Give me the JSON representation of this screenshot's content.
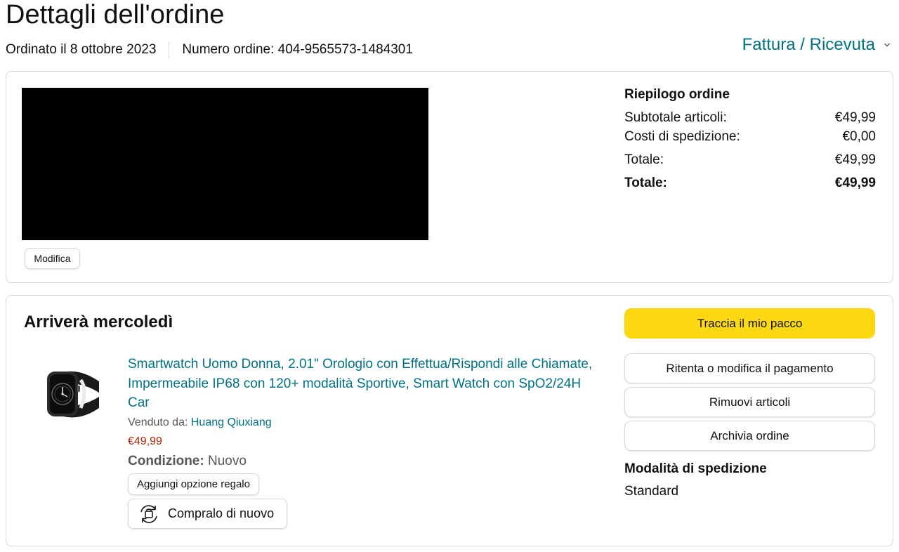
{
  "page": {
    "title": "Dettagli dell'ordine",
    "order_date": "Ordinato il 8 ottobre 2023",
    "order_number": "Numero ordine: 404-9565573-1484301",
    "invoice_link": "Fattura / Ricevuta"
  },
  "address_card": {
    "edit_button": "Modifica"
  },
  "summary": {
    "title": "Riepilogo ordine",
    "rows": [
      {
        "label": "Subtotale articoli:",
        "value": "€49,99"
      },
      {
        "label": "Costi di spedizione:",
        "value": "€0,00"
      },
      {
        "label": "Totale:",
        "value": "€49,99"
      },
      {
        "label": "Totale:",
        "value": "€49,99"
      }
    ]
  },
  "shipment": {
    "arrival": "Arriverà mercoledì",
    "product": {
      "title": "Smartwatch Uomo Donna, 2.01\" Orologio con Effettua/Rispondi alle Chiamate, Impermeabile IP68 con 120+ modalità Sportive, Smart Watch con SpO2/24H Car",
      "sold_by_label": "Venduto da:",
      "seller": "Huang Qiuxiang",
      "price": "€49,99",
      "condition_label": "Condizione:",
      "condition_value": "Nuovo"
    },
    "gift_button": "Aggiungi opzione regalo",
    "buy_again_button": "Compralo di nuovo",
    "actions": {
      "track": "Traccia il mio pacco",
      "retry_payment": "Ritenta o modifica il pagamento",
      "remove_items": "Rimuovi articoli",
      "archive": "Archivia ordine"
    },
    "shipping_method_title": "Modalità di spedizione",
    "shipping_method": "Standard"
  },
  "colors": {
    "link": "#007185",
    "price": "#b12704",
    "primary_button": "#ffd814",
    "border": "#d5d9d9"
  }
}
